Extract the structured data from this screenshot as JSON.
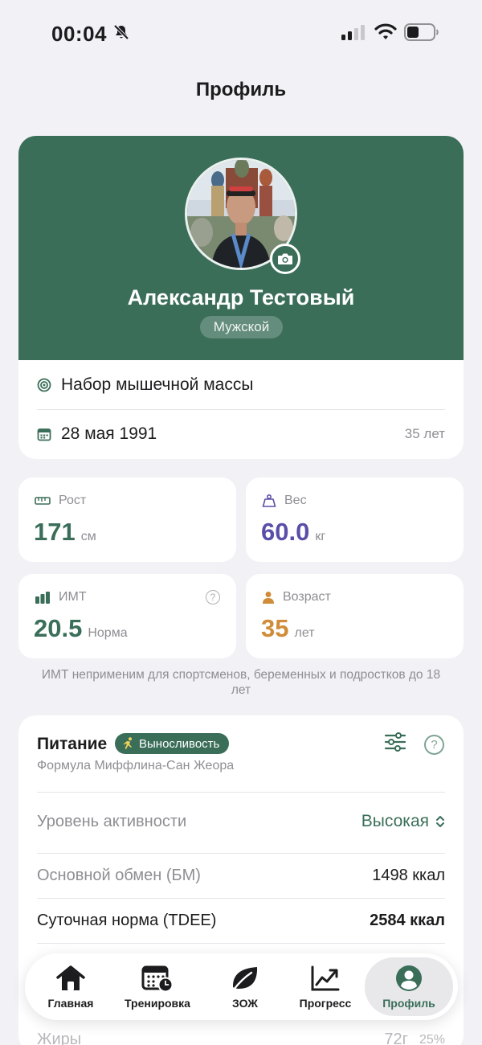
{
  "status_bar": {
    "time": "00:04"
  },
  "header": {
    "title": "Профиль"
  },
  "profile": {
    "name": "Александр Тестовый",
    "gender": "Мужской",
    "goal": "Набор мышечной массы",
    "birth_date": "28 мая 1991",
    "age_text": "35 лет"
  },
  "stats": {
    "height": {
      "label": "Рост",
      "value": "171",
      "unit": "см",
      "color": "#3a6e59"
    },
    "weight": {
      "label": "Вес",
      "value": "60.0",
      "unit": "кг",
      "color": "#5a4fa8"
    },
    "bmi": {
      "label": "ИМТ",
      "value": "20.5",
      "unit": "Норма",
      "color": "#3a6e59"
    },
    "age": {
      "label": "Возраст",
      "value": "35",
      "unit": "лет",
      "color": "#d08c38"
    }
  },
  "bmi_note": "ИМТ неприменим для спортсменов, беременных и подростков до 18 лет",
  "nutrition": {
    "title": "Питание",
    "badge": "Выносливость",
    "formula": "Формула Миффлина-Сан Жеора",
    "activity_label": "Уровень активности",
    "activity_value": "Высокая",
    "bmr_label": "Основной обмен (БМ)",
    "bmr_value": "1498 ккал",
    "tdee_label": "Суточная норма (TDEE)",
    "tdee_value": "2584 ккал",
    "fat_label": "Жиры",
    "fat_value": "72г",
    "fat_percent": "25%"
  },
  "tabs": [
    {
      "label": "Главная",
      "icon": "house-icon"
    },
    {
      "label": "Тренировка",
      "icon": "calendar-clock-icon"
    },
    {
      "label": "ЗОЖ",
      "icon": "leaf-icon"
    },
    {
      "label": "Прогресс",
      "icon": "chart-up-icon"
    },
    {
      "label": "Профиль",
      "icon": "person-circle-icon"
    }
  ],
  "colors": {
    "accent": "#3a6e59",
    "background": "#f2f2f6"
  }
}
